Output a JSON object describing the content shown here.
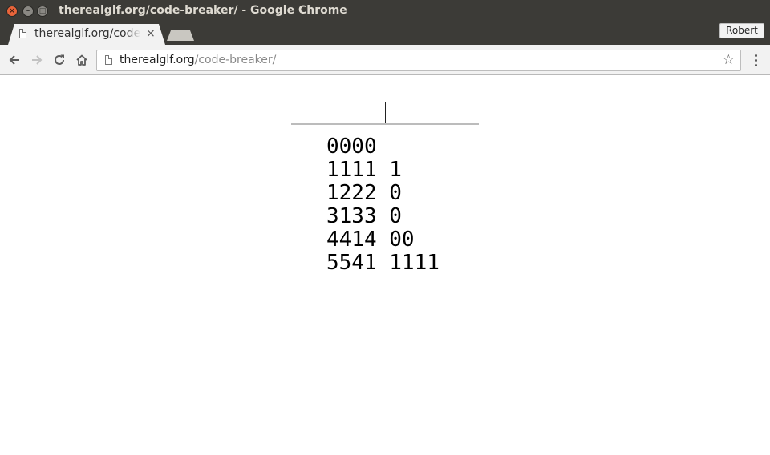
{
  "window": {
    "title": "therealglf.org/code-breaker/ - Google Chrome",
    "close_glyph": "×",
    "minimize_glyph": "–",
    "maximize_glyph": "□"
  },
  "tab": {
    "title": "therealglf.org/code-breaker/",
    "close_glyph": "×"
  },
  "profile": {
    "name": "Robert"
  },
  "address_bar": {
    "host": "therealglf.org",
    "path": "/code-breaker/"
  },
  "icons": {
    "page": "page-icon",
    "back": "back-arrow-icon",
    "forward": "forward-arrow-icon",
    "reload": "reload-icon",
    "home": "home-icon",
    "bookmark": "star-icon",
    "menu": "more-vert-icon"
  },
  "colors": {
    "titlebar": "#3c3b37",
    "close_button": "#e8643a",
    "toolbar": "#f2f2f2"
  },
  "page": {
    "guess_value": "",
    "history": [
      {
        "guess": "0000",
        "feedback": ""
      },
      {
        "guess": "1111",
        "feedback": "1"
      },
      {
        "guess": "1222",
        "feedback": "0"
      },
      {
        "guess": "3133",
        "feedback": "0"
      },
      {
        "guess": "4414",
        "feedback": "00"
      },
      {
        "guess": "5541",
        "feedback": "1111"
      }
    ]
  }
}
